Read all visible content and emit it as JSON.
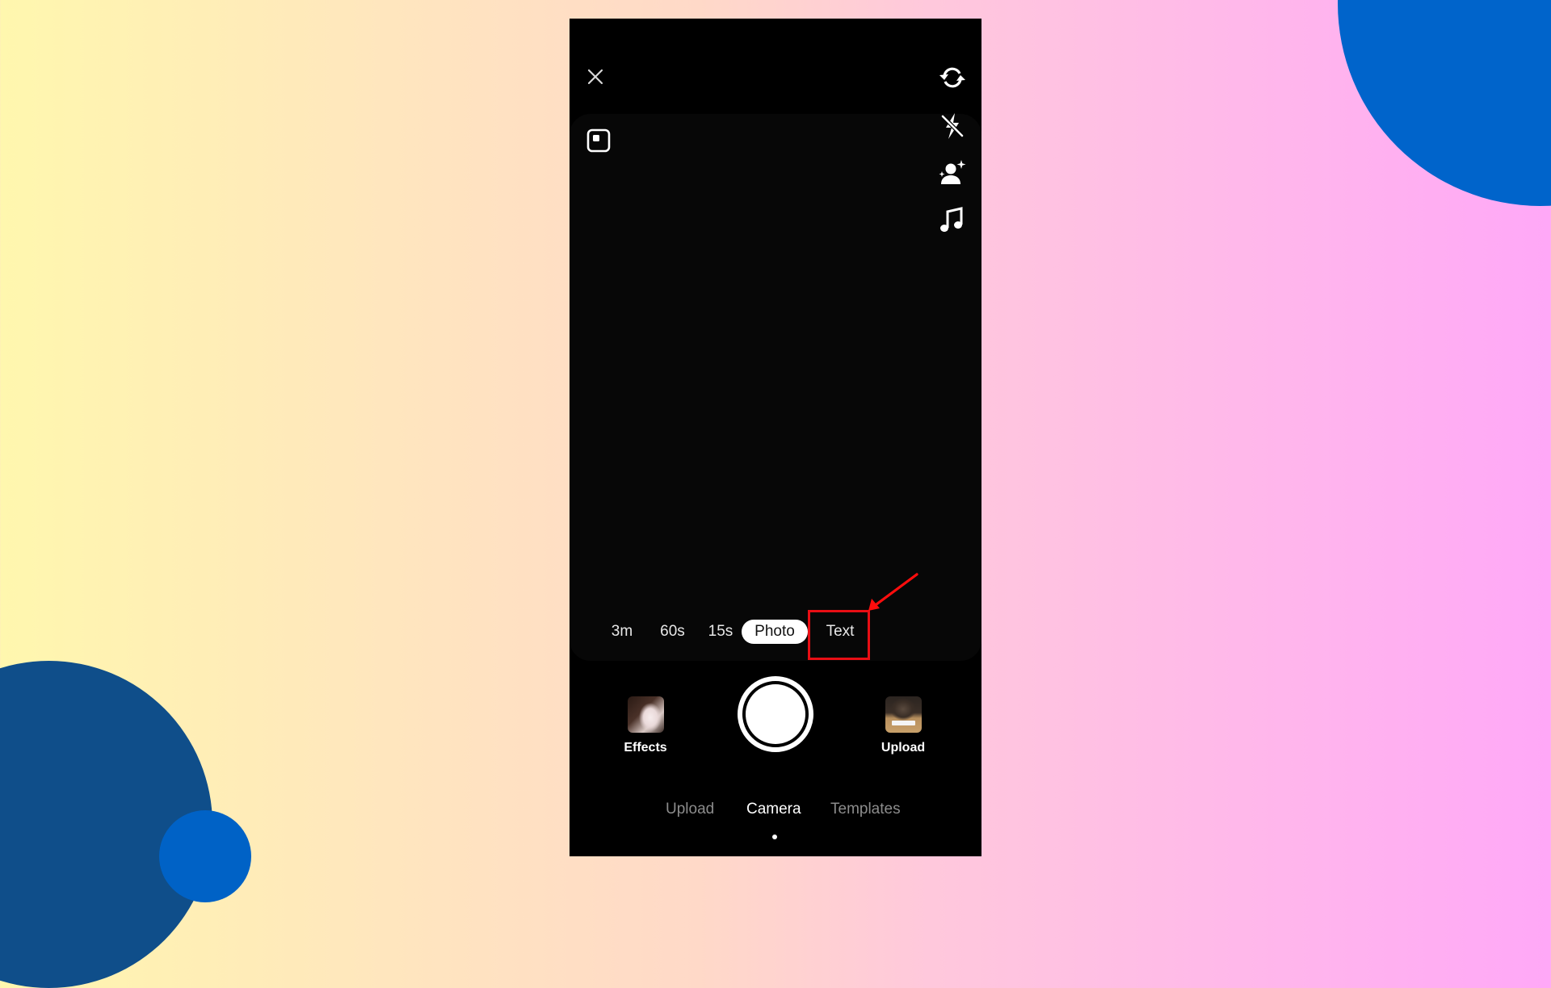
{
  "background": {
    "gradient_left": "#FFF7AE",
    "gradient_right": "#FFA8F7",
    "decor_circle_colors": [
      "#0064CB",
      "#0F4E8A",
      "#0062C6"
    ]
  },
  "camera": {
    "top_left_icons": [
      {
        "name": "close-icon",
        "action": "close"
      },
      {
        "name": "layout-icon",
        "action": "layout"
      }
    ],
    "right_toolbar": [
      {
        "name": "flip-camera-icon",
        "action": "flip"
      },
      {
        "name": "flash-off-icon",
        "action": "flash"
      },
      {
        "name": "beauty-icon",
        "action": "enhance"
      },
      {
        "name": "music-icon",
        "action": "add-sound"
      }
    ],
    "modes": [
      {
        "label": "3m",
        "selected": false
      },
      {
        "label": "60s",
        "selected": false
      },
      {
        "label": "15s",
        "selected": false
      },
      {
        "label": "Photo",
        "selected": true
      },
      {
        "label": "Text",
        "selected": false,
        "highlighted": true
      }
    ],
    "effects_label": "Effects",
    "upload_label": "Upload",
    "bottom_tabs": [
      {
        "label": "Upload",
        "active": false
      },
      {
        "label": "Camera",
        "active": true
      },
      {
        "label": "Templates",
        "active": false
      }
    ]
  },
  "annotation": {
    "highlight_color": "#E80E14",
    "target": "Text"
  }
}
